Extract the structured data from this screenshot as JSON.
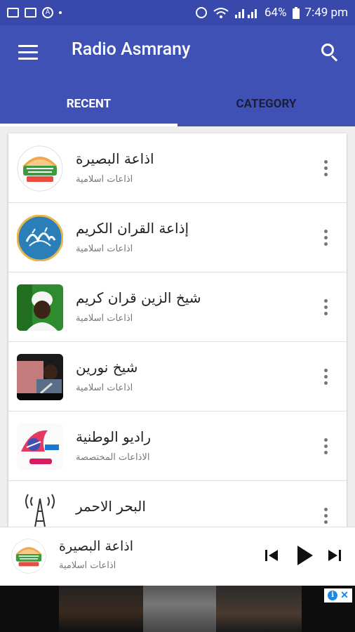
{
  "status": {
    "battery": "64%",
    "time": "7:49 pm"
  },
  "appbar": {
    "title": "Radio Asmrany"
  },
  "tabs": [
    {
      "label": "RECENT",
      "active": true
    },
    {
      "label": "CATEGORY",
      "active": false
    }
  ],
  "stations": [
    {
      "title": "اذاعة البصيرة",
      "subtitle": "اذاعات اسلامية",
      "icon": "albasira-logo-icon"
    },
    {
      "title": "إذاعة القران الكريم",
      "subtitle": "اذاعات اسلامية",
      "icon": "quran-calligraphy-icon"
    },
    {
      "title": "شيخ الزين قران كريم",
      "subtitle": "اذاعات اسلامية",
      "icon": "sheikh-portrait-icon"
    },
    {
      "title": "شيخ نورين",
      "subtitle": "اذاعات اسلامية",
      "icon": "sheikh-photo-icon"
    },
    {
      "title": "راديو الوطنية",
      "subtitle": "الاذاعات المختصصة",
      "icon": "watania-logo-icon"
    },
    {
      "title": "البحر الاحمر",
      "subtitle": "",
      "icon": "radio-tower-icon"
    }
  ],
  "player": {
    "title": "اذاعة البصيرة",
    "subtitle": "اذاعات اسلامية"
  },
  "colors": {
    "status_bar": "#3949ab",
    "app_bar": "#3f51b5",
    "tab_inactive_text": "#1a1f3a"
  }
}
